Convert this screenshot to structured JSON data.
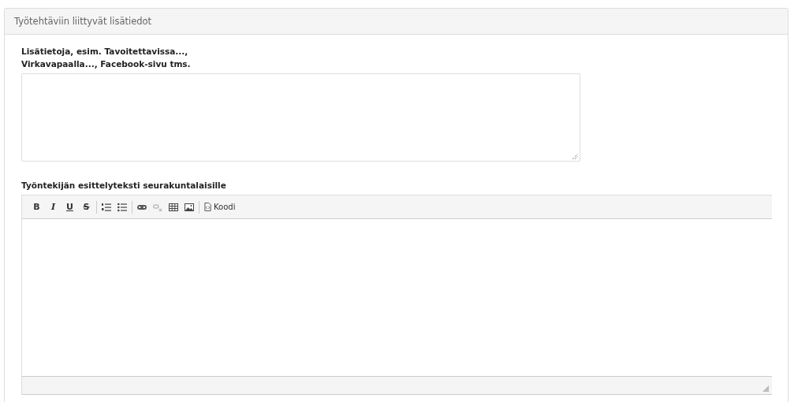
{
  "panel": {
    "title": "Työtehtäviin liittyvät lisätiedot"
  },
  "fields": [
    {
      "kind": "textarea",
      "label_lines": [
        "Lisätietoja, esim. Tavoitettavissa...,",
        "Virkavapaalla..., Facebook-sivu tms."
      ]
    },
    {
      "kind": "editor",
      "label_lines": [
        "Työntekijän esittelyteksti seurakuntalaisille"
      ],
      "toolbar": [
        {
          "kind": "bold",
          "label": "B",
          "disabled": false
        },
        {
          "kind": "italic",
          "label": "I",
          "disabled": false
        },
        {
          "kind": "underline",
          "label": "U",
          "disabled": false
        },
        {
          "kind": "strike",
          "label": "S",
          "disabled": false
        },
        {
          "kind": "separator"
        },
        {
          "kind": "ordered-list",
          "disabled": false
        },
        {
          "kind": "bullet-list",
          "disabled": false
        },
        {
          "kind": "separator"
        },
        {
          "kind": "link",
          "disabled": false
        },
        {
          "kind": "unlink",
          "disabled": true
        },
        {
          "kind": "table",
          "disabled": false
        },
        {
          "kind": "image",
          "disabled": false
        },
        {
          "kind": "separator"
        },
        {
          "kind": "code",
          "label": "Koodi",
          "disabled": false
        }
      ]
    }
  ]
}
